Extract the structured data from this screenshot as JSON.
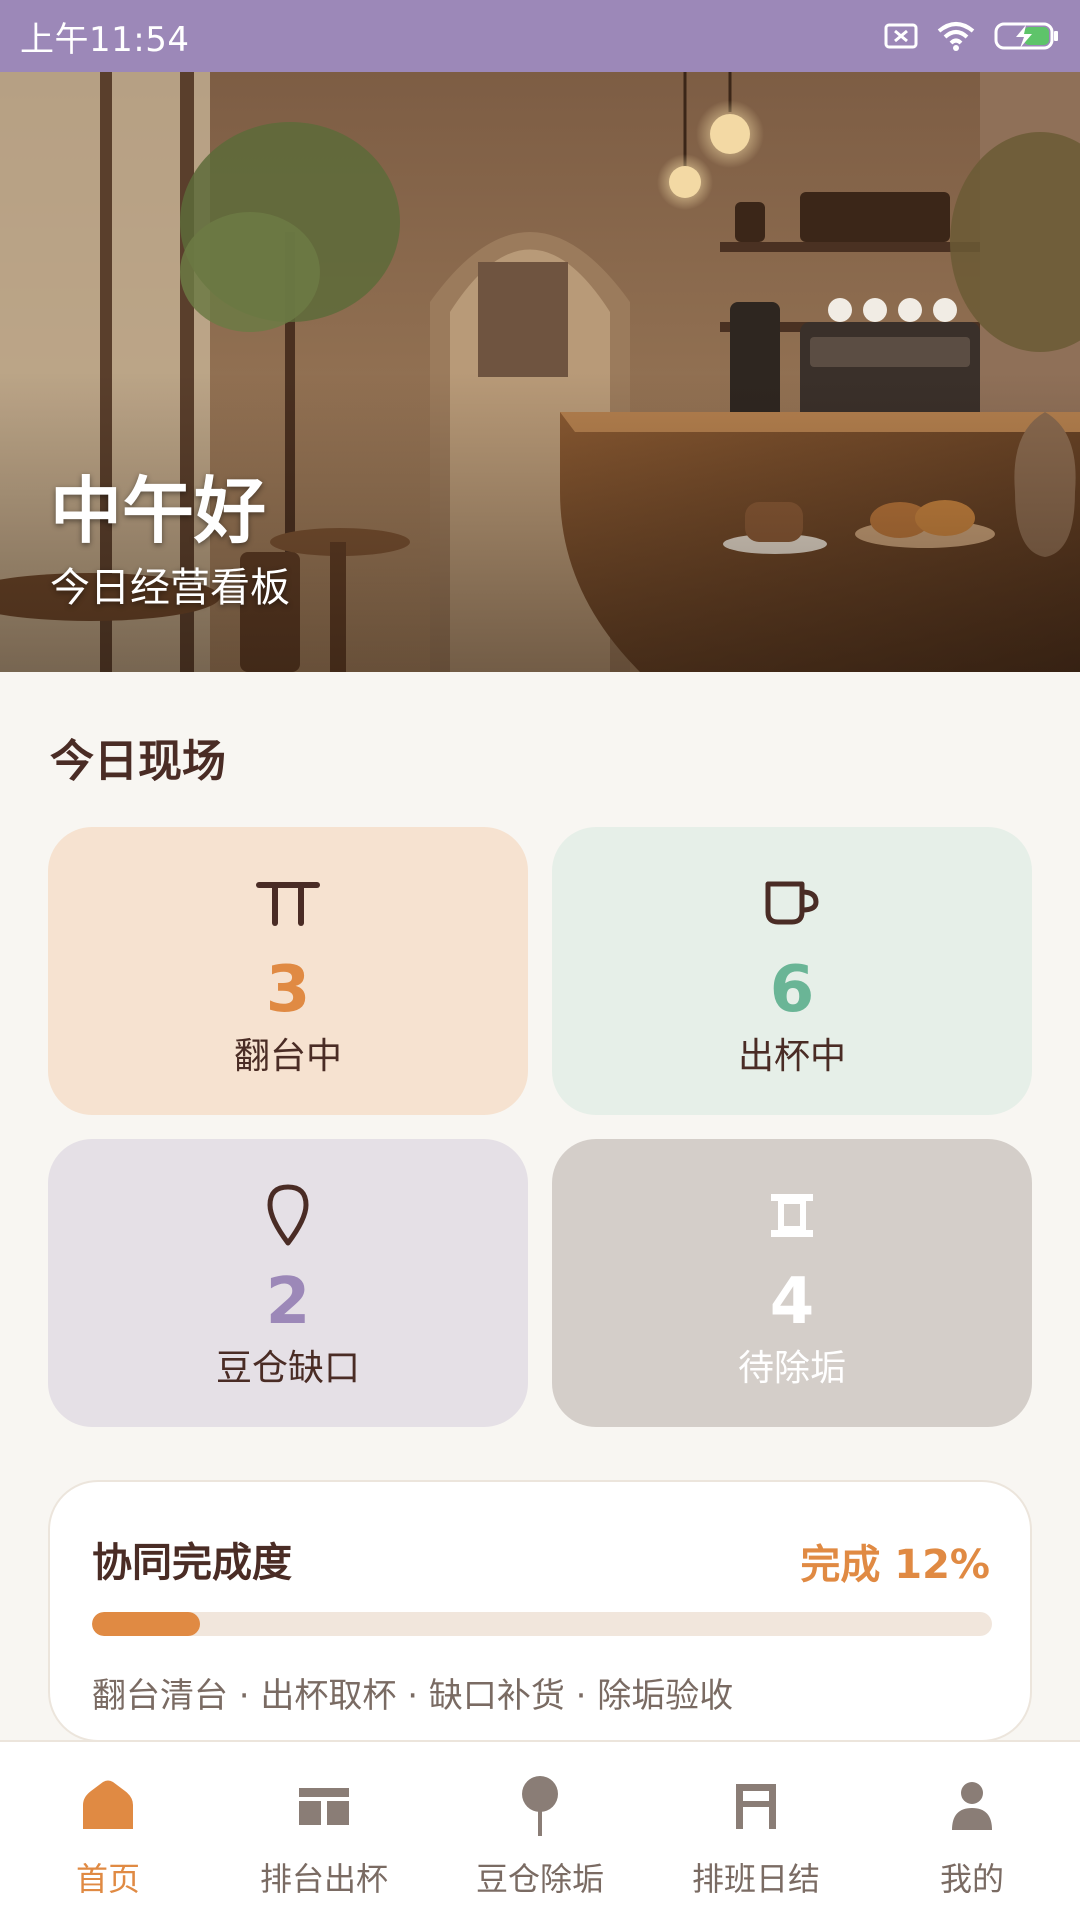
{
  "status_bar": {
    "time": "上午11:54",
    "icons": [
      "sim-off-icon",
      "wifi-icon",
      "battery-charging-icon"
    ]
  },
  "hero": {
    "greeting": "中午好",
    "subtitle": "今日经营看板"
  },
  "section": {
    "title": "今日现场"
  },
  "tiles": [
    {
      "icon": "table-icon",
      "value": "3",
      "label": "翻台中",
      "color": "#e08a43"
    },
    {
      "icon": "cup-icon",
      "value": "6",
      "label": "出杯中",
      "color": "#6ab596"
    },
    {
      "icon": "bean-icon",
      "value": "2",
      "label": "豆仓缺口",
      "color": "#9c88b8"
    },
    {
      "icon": "descale-icon",
      "value": "4",
      "label": "待除垢",
      "color": "#ffffff"
    }
  ],
  "progress": {
    "title": "协同完成度",
    "percent_label": "完成 12%",
    "percent_value": 12,
    "steps": "翻台清台 · 出杯取杯 · 缺口补货 · 除垢验收"
  },
  "nav": {
    "items": [
      {
        "icon": "home-icon",
        "label": "首页",
        "active": true
      },
      {
        "icon": "table-cup-icon",
        "label": "排台出杯",
        "active": false
      },
      {
        "icon": "bean-icon",
        "label": "豆仓除垢",
        "active": false
      },
      {
        "icon": "schedule-icon",
        "label": "排班日结",
        "active": false
      },
      {
        "icon": "user-icon",
        "label": "我的",
        "active": false
      }
    ]
  },
  "colors": {
    "accent": "#e08a43",
    "status_bar": "#9c88b8",
    "text_dark": "#4a2c25",
    "text_muted": "#7a6b63"
  }
}
